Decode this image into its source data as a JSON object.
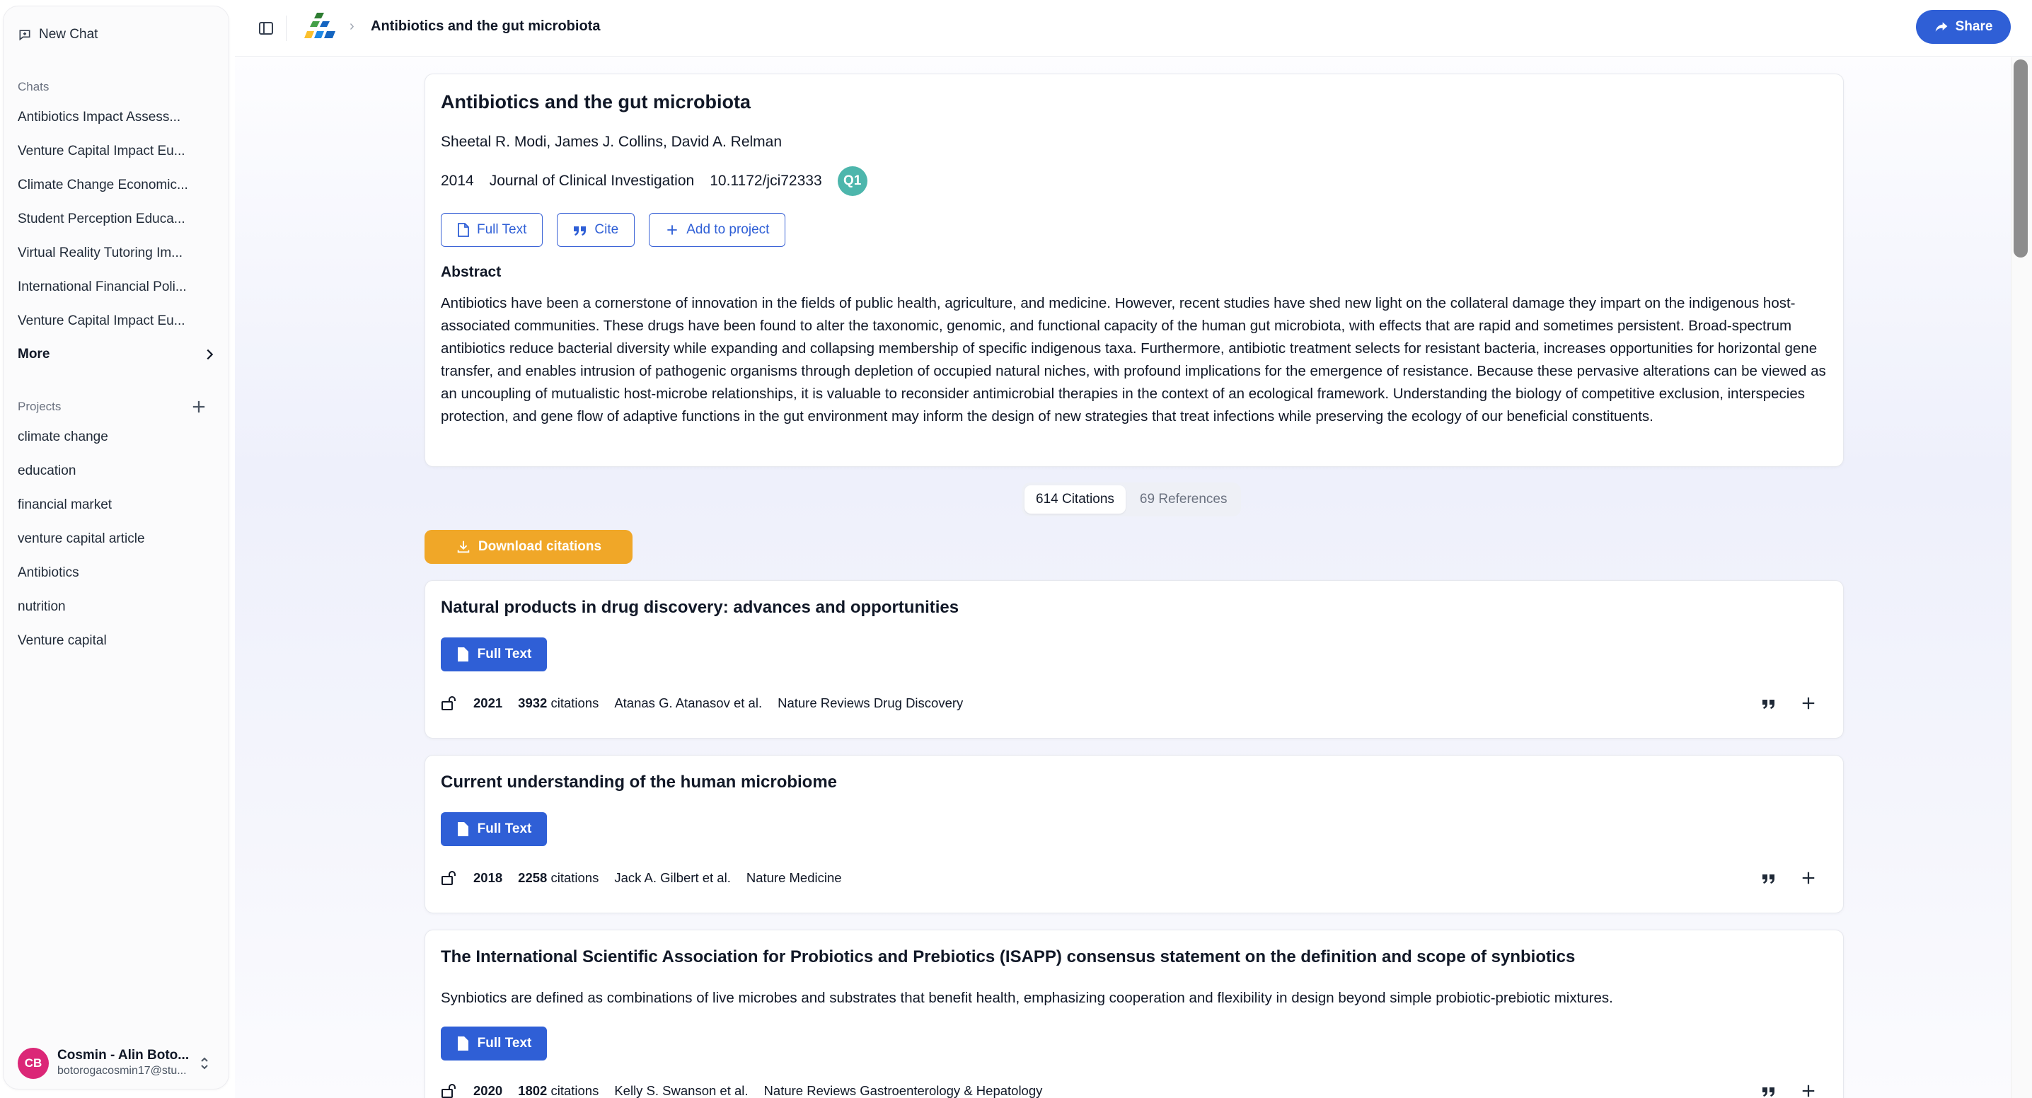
{
  "sidebar": {
    "new_chat_label": "New Chat",
    "chats_title": "Chats",
    "chats": [
      "Antibiotics Impact Assess...",
      "Venture Capital Impact Eu...",
      "Climate Change Economic...",
      "Student Perception Educa...",
      "Virtual Reality Tutoring Im...",
      "International Financial Poli...",
      "Venture Capital Impact Eu..."
    ],
    "more_label": "More",
    "projects_title": "Projects",
    "projects": [
      "climate change",
      "education",
      "financial market",
      "venture capital article",
      "Antibiotics",
      "nutrition",
      "Venture capital"
    ],
    "user": {
      "initials": "CB",
      "name": "Cosmin - Alin Boto...",
      "email": "botorogacosmin17@stu..."
    }
  },
  "header": {
    "breadcrumb_title": "Antibiotics and the gut microbiota",
    "share_label": "Share"
  },
  "paper": {
    "title": "Antibiotics and the gut microbiota",
    "authors": "Sheetal R. Modi, James J. Collins, David A. Relman",
    "year": "2014",
    "journal": "Journal of Clinical Investigation",
    "doi": "10.1172/jci72333",
    "quartile": "Q1",
    "full_text_label": "Full Text",
    "cite_label": "Cite",
    "add_project_label": "Add to project",
    "abstract_heading": "Abstract",
    "abstract": "Antibiotics have been a cornerstone of innovation in the fields of public health, agriculture, and medicine. However, recent studies have shed new light on the collateral damage they impart on the indigenous host-associated communities. These drugs have been found to alter the taxonomic, genomic, and functional capacity of the human gut microbiota, with effects that are rapid and sometimes persistent. Broad-spectrum antibiotics reduce bacterial diversity while expanding and collapsing membership of specific indigenous taxa. Furthermore, antibiotic treatment selects for resistant bacteria, increases opportunities for horizontal gene transfer, and enables intrusion of pathogenic organisms through depletion of occupied natural niches, with profound implications for the emergence of resistance. Because these pervasive alterations can be viewed as an uncoupling of mutualistic host-microbe relationships, it is valuable to reconsider antimicrobial therapies in the context of an ecological framework. Understanding the biology of competitive exclusion, interspecies protection, and gene flow of adaptive functions in the gut environment may inform the design of new strategies that treat infections while preserving the ecology of our beneficial constituents."
  },
  "tabs": {
    "citations": "614 Citations",
    "references": "69 References"
  },
  "download_label": "Download citations",
  "results": [
    {
      "title": "Natural products in drug discovery: advances and opportunities",
      "snippet": "",
      "full_text_label": "Full Text",
      "year": "2021",
      "citation_count": "3932",
      "citations_word": "citations",
      "authors": "Atanas G. Atanasov et al.",
      "journal": "Nature Reviews Drug Discovery"
    },
    {
      "title": "Current understanding of the human microbiome",
      "snippet": "",
      "full_text_label": "Full Text",
      "year": "2018",
      "citation_count": "2258",
      "citations_word": "citations",
      "authors": "Jack A. Gilbert et al.",
      "journal": "Nature Medicine"
    },
    {
      "title": "The International Scientific Association for Probiotics and Prebiotics (ISAPP) consensus statement on the definition and scope of synbiotics",
      "snippet": "Synbiotics are defined as combinations of live microbes and substrates that benefit health, emphasizing cooperation and flexibility in design beyond simple probiotic-prebiotic mixtures.",
      "full_text_label": "Full Text",
      "year": "2020",
      "citation_count": "1802",
      "citations_word": "citations",
      "authors": "Kelly S. Swanson et al.",
      "journal": "Nature Reviews Gastroenterology & Hepatology"
    }
  ],
  "colors": {
    "primary": "#2f5fd6",
    "download": "#f0a728",
    "quartile_badge": "#4db6ac",
    "avatar": "#db2777"
  },
  "icons": [
    "chat-icon",
    "chevron-right-icon",
    "plus-icon",
    "sidebar-toggle-icon",
    "share-icon",
    "document-icon",
    "quote-icon",
    "download-icon",
    "unlock-icon",
    "chevron-updown-icon"
  ]
}
